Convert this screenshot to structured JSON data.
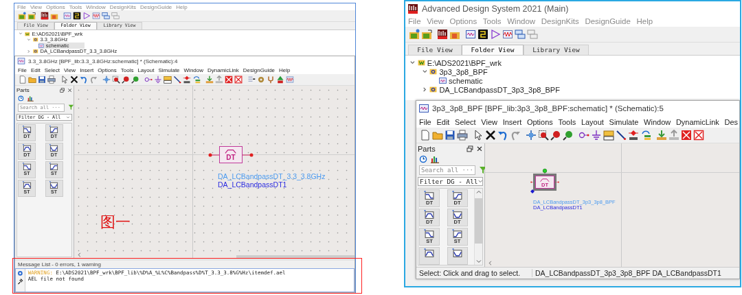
{
  "screenshots": [
    {
      "menu": [
        "File",
        "View",
        "Options",
        "Tools",
        "Window",
        "DesignKits",
        "DesignGuide",
        "Help"
      ],
      "tabs": [
        {
          "label": "File View",
          "selected": false
        },
        {
          "label": "Folder View",
          "selected": true
        },
        {
          "label": "Library View",
          "selected": false
        }
      ],
      "tree": [
        {
          "label": "E:\\ADS2021\\BPF_wrk",
          "kind": "workspace",
          "expanded": true,
          "selected": false,
          "children": [
            {
              "label": "3.3_3.8GHz",
              "kind": "cell",
              "expanded": true,
              "selected": false,
              "children": [
                {
                  "label": "schematic",
                  "kind": "schematic",
                  "selected": true
                }
              ]
            },
            {
              "label": "DA_LCBandpassDT_3.3_3.8GHz",
              "kind": "cell",
              "expanded": false,
              "selected": false
            }
          ]
        }
      ],
      "schematic_window": {
        "title": "3.3_3.8GHz [BPF_lib:3.3_3.8GHz:schematic] * (Schematic):4",
        "menu": [
          "File",
          "Edit",
          "Select",
          "View",
          "Insert",
          "Options",
          "Tools",
          "Layout",
          "Simulate",
          "Window",
          "DynamicLink",
          "DesignGuide",
          "Help"
        ],
        "parts": {
          "title": "Parts",
          "search": {
            "placeholder": "Search all ···"
          },
          "filter": "Filter DG - All",
          "palette": [
            {
              "kind": "lowpass",
              "label": "DT"
            },
            {
              "kind": "highpass",
              "label": "DT"
            },
            {
              "kind": "bandpass",
              "label": "DT"
            },
            {
              "kind": "bandstop",
              "label": "DT"
            },
            {
              "kind": "lowpass",
              "label": "ST"
            },
            {
              "kind": "highpass",
              "label": "ST"
            },
            {
              "kind": "bandpass",
              "label": "ST"
            },
            {
              "kind": "bandstop",
              "label": "ST"
            }
          ]
        },
        "component": {
          "symbol": "DT",
          "labels": [
            "DA_LCBandpassDT_3.3_3.8GHz",
            "DA_LCBandpassDT1"
          ]
        },
        "annotation": "图一",
        "message_list": {
          "title": "Message List - 0 errors, 1 warning",
          "messages": [
            {
              "kind": "warning",
              "level": "WARNING:",
              "path": "E:\\ADS2021\\BPF_wrk\\BPF_lib\\%D%A_%L%C%Bandpass%D%T_3.3_3.8%G%Hz\\itemdef.ael",
              "detail": "AEL file not found"
            }
          ]
        }
      }
    },
    {
      "title": "Advanced Design System 2021 (Main)",
      "menu": [
        "File",
        "View",
        "Options",
        "Tools",
        "Window",
        "DesignKits",
        "DesignGuide",
        "Help"
      ],
      "tabs": [
        {
          "label": "File View",
          "selected": false
        },
        {
          "label": "Folder View",
          "selected": true
        },
        {
          "label": "Library View",
          "selected": false
        }
      ],
      "tree": [
        {
          "label": "E:\\ADS2021\\BPF_wrk",
          "kind": "workspace",
          "expanded": true,
          "selected": false,
          "children": [
            {
              "label": "3p3_3p8_BPF",
              "kind": "cell",
              "expanded": true,
              "selected": false,
              "children": [
                {
                  "label": "schematic",
                  "kind": "schematic",
                  "selected": false
                }
              ]
            },
            {
              "label": "DA_LCBandpassDT_3p3_3p8_BPF",
              "kind": "cell",
              "expanded": false,
              "selected": false
            }
          ]
        }
      ],
      "schematic_window": {
        "title": "3p3_3p8_BPF [BPF_lib:3p3_3p8_BPF:schematic] * (Schematic):5",
        "menu": [
          "File",
          "Edit",
          "Select",
          "View",
          "Insert",
          "Options",
          "Tools",
          "Layout",
          "Simulate",
          "Window",
          "DynamicLink",
          "Des"
        ],
        "parts": {
          "title": "Parts",
          "search": {
            "placeholder": "Search all ···"
          },
          "filter": "Filter DG - All",
          "palette": [
            {
              "kind": "lowpass",
              "label": "DT"
            },
            {
              "kind": "highpass",
              "label": "DT"
            },
            {
              "kind": "bandpass",
              "label": "DT"
            },
            {
              "kind": "bandstop",
              "label": "DT"
            },
            {
              "kind": "lowpass",
              "label": "ST"
            },
            {
              "kind": "highpass",
              "label": "ST"
            },
            {
              "kind": "bandpass"
            },
            {
              "kind": "bandstop"
            }
          ]
        },
        "component": {
          "symbol": "DT",
          "labels": [
            "DA_LCBandpassDT_3p3_3p8_BPF",
            "DA_LCBandpassDT1"
          ]
        },
        "status_bar": [
          "Select: Click and drag to select.",
          "DA_LCBandpassDT_3p3_3p8_BPF DA_LCBandpassDT1"
        ]
      }
    }
  ]
}
